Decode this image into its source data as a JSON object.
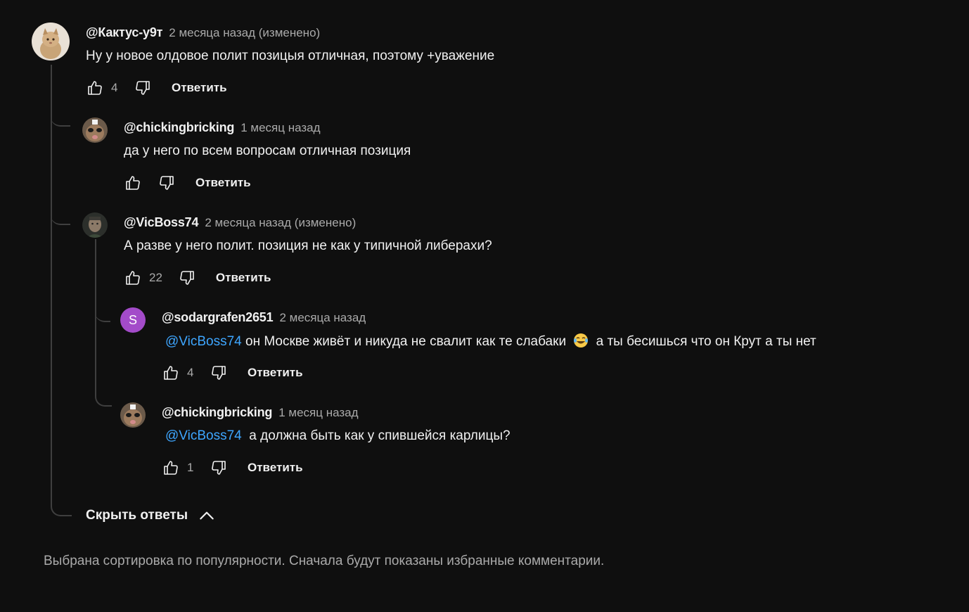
{
  "comments": [
    {
      "author": "@Кактус-у9т",
      "time": "2 месяца назад (изменено)",
      "text": "Ну у новое олдовое полит позицыя отличная, поэтому +уважение",
      "likes": "4",
      "reply_label": "Ответить"
    },
    {
      "author": "@chickingbricking",
      "time": "1 месяц назад",
      "text": "да у него по всем вопросам отличная позиция",
      "likes": "",
      "reply_label": "Ответить"
    },
    {
      "author": "@VicBoss74",
      "time": "2 месяца назад (изменено)",
      "text": "А разве у него полит. позиция не как у типичной либерахи?",
      "likes": "22",
      "reply_label": "Ответить"
    },
    {
      "author": "@sodargrafen2651",
      "avatar_letter": "S",
      "avatar_color": "#a34bc9",
      "time": "2 месяца назад",
      "mention": "@VicBoss74",
      "text_before_emoji": " он Москве живёт и никуда не свалит как те слабаки",
      "emoji": "face-with-tears-of-joy",
      "text_after_emoji": "а ты бесишься что он Крут а ты нет",
      "likes": "4",
      "reply_label": "Ответить"
    },
    {
      "author": "@chickingbricking",
      "time": "1 месяц назад",
      "mention": "@VicBoss74",
      "text": "  а должна быть как у спившейся карлицы?",
      "likes": "1",
      "reply_label": "Ответить"
    }
  ],
  "hide_replies_label": "Скрыть ответы",
  "sort_note": "Выбрана сортировка по популярности. Сначала будут показаны избранные комментарии.",
  "colors": {
    "background": "#0f0f0f",
    "mention": "#3ea6ff",
    "secondary_text": "#aaaaaa"
  },
  "icons": {
    "like": "thumb-up-icon",
    "dislike": "thumb-down-icon",
    "collapse": "chevron-up-icon"
  }
}
